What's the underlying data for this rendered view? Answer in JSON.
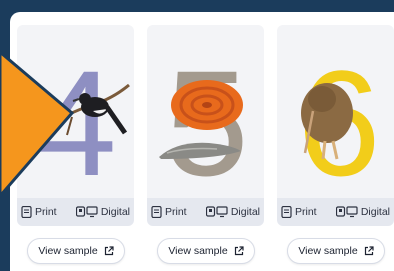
{
  "colors": {
    "frame_border": "#1b3c5c",
    "card_bg": "#f3f4f7",
    "formats_bg": "#e5e8ef",
    "accent_arrow": "#f5961d",
    "numeral_4": "#8e8fc2",
    "numeral_5": "#a39a8e",
    "numeral_6": "#f2cd1a"
  },
  "cards": [
    {
      "numeral": "4",
      "subject": "magpie robin on a branch",
      "formats": {
        "print_label": "Print",
        "digital_label": "Digital"
      },
      "sample_label": "View sample"
    },
    {
      "numeral": "5",
      "subject": "snail",
      "formats": {
        "print_label": "Print",
        "digital_label": "Digital"
      },
      "sample_label": "View sample"
    },
    {
      "numeral": "6",
      "subject": "kiwi bird",
      "formats": {
        "print_label": "Print",
        "digital_label": "Digital"
      },
      "sample_label": "View sample"
    }
  ],
  "icons": {
    "print": "document-icon",
    "digital": "tablet-desktop-icon",
    "sample": "external-link-icon",
    "carousel": "arrow-left-icon"
  }
}
